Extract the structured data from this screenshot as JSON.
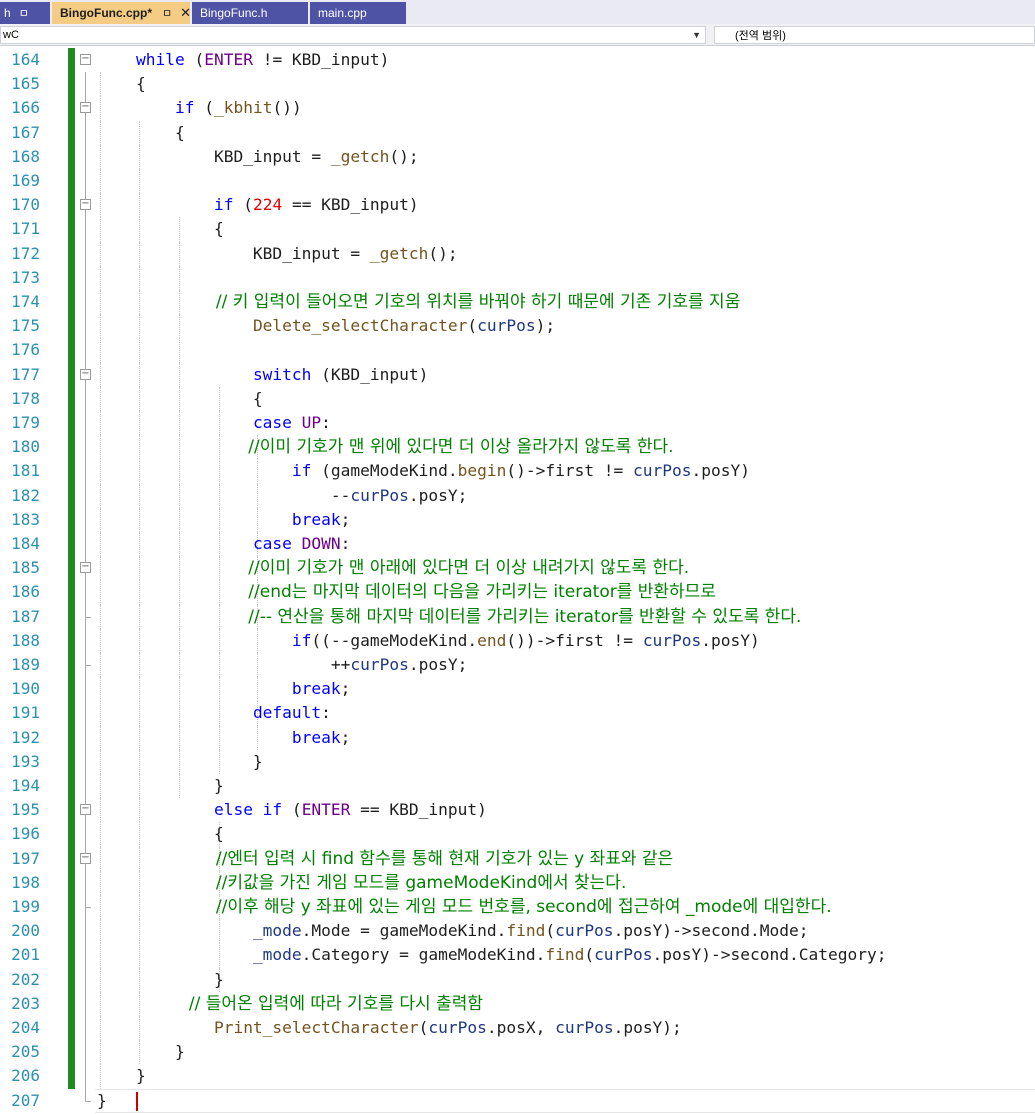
{
  "tabs": [
    {
      "label": "h",
      "pin": "ㅁ",
      "style": "edge"
    },
    {
      "label": "BingoFunc.cpp*",
      "pin": "ㅁ",
      "close": "✕",
      "style": "active"
    },
    {
      "label": "BingoFunc.h",
      "style": "inactive"
    },
    {
      "label": "main.cpp",
      "style": "inactive"
    }
  ],
  "navbar": {
    "left_value": "wC",
    "right_value": "(전역 범위)"
  },
  "colors": {
    "keyword": "#0000ff",
    "macro": "#6f008a",
    "function": "#74531f",
    "number": "#e00000",
    "variable": "#1f377f",
    "comment": "#008000",
    "line_number": "#2b91af",
    "change_bar": "#1f8a1f"
  },
  "editor": {
    "lines": [
      {
        "n": "164",
        "tokens": [
          {
            "t": "    "
          },
          {
            "t": "while",
            "c": "kw"
          },
          {
            "t": " ("
          },
          {
            "t": "ENTER",
            "c": "mac"
          },
          {
            "t": " != KBD_input)"
          }
        ]
      },
      {
        "n": "165",
        "tokens": [
          {
            "t": "    {"
          }
        ]
      },
      {
        "n": "166",
        "tokens": [
          {
            "t": "        "
          },
          {
            "t": "if",
            "c": "kw"
          },
          {
            "t": " ("
          },
          {
            "t": "_kbhit",
            "c": "fn"
          },
          {
            "t": "())"
          }
        ]
      },
      {
        "n": "167",
        "tokens": [
          {
            "t": "        {"
          }
        ]
      },
      {
        "n": "168",
        "tokens": [
          {
            "t": "            KBD_input = "
          },
          {
            "t": "_getch",
            "c": "fn"
          },
          {
            "t": "();"
          }
        ]
      },
      {
        "n": "169",
        "tokens": []
      },
      {
        "n": "170",
        "tokens": [
          {
            "t": "            "
          },
          {
            "t": "if",
            "c": "kw"
          },
          {
            "t": " ("
          },
          {
            "t": "224",
            "c": "num"
          },
          {
            "t": " == KBD_input)"
          }
        ]
      },
      {
        "n": "171",
        "tokens": [
          {
            "t": "            {"
          }
        ]
      },
      {
        "n": "172",
        "tokens": [
          {
            "t": "                KBD_input = "
          },
          {
            "t": "_getch",
            "c": "fn"
          },
          {
            "t": "();"
          }
        ]
      },
      {
        "n": "173",
        "tokens": []
      },
      {
        "n": "174",
        "comment": true,
        "tokens": [
          {
            "t": "                      // 키 입력이 들어오면 기호의 위치를 바꿔야 하기 때문에 기존 기호를 지움",
            "c": "cmt"
          }
        ]
      },
      {
        "n": "175",
        "tokens": [
          {
            "t": "                "
          },
          {
            "t": "Delete_selectCharacter",
            "c": "fn"
          },
          {
            "t": "("
          },
          {
            "t": "curPos",
            "c": "var"
          },
          {
            "t": ");"
          }
        ]
      },
      {
        "n": "176",
        "tokens": []
      },
      {
        "n": "177",
        "tokens": [
          {
            "t": "                "
          },
          {
            "t": "switch",
            "c": "kw"
          },
          {
            "t": " (KBD_input)"
          }
        ]
      },
      {
        "n": "178",
        "tokens": [
          {
            "t": "                {"
          }
        ]
      },
      {
        "n": "179",
        "tokens": [
          {
            "t": "                "
          },
          {
            "t": "case",
            "c": "kw"
          },
          {
            "t": " "
          },
          {
            "t": "UP",
            "c": "mac"
          },
          {
            "t": ":"
          }
        ]
      },
      {
        "n": "180",
        "comment": true,
        "tokens": [
          {
            "t": "                            //이미 기호가 맨 위에 있다면 더 이상 올라가지 않도록 한다.",
            "c": "cmt"
          }
        ]
      },
      {
        "n": "181",
        "tokens": [
          {
            "t": "                    "
          },
          {
            "t": "if",
            "c": "kw"
          },
          {
            "t": " (gameModeKind."
          },
          {
            "t": "begin",
            "c": "fn"
          },
          {
            "t": "()->first != "
          },
          {
            "t": "curPos",
            "c": "var"
          },
          {
            "t": ".posY)"
          }
        ]
      },
      {
        "n": "182",
        "tokens": [
          {
            "t": "                        --"
          },
          {
            "t": "curPos",
            "c": "var"
          },
          {
            "t": ".posY;"
          }
        ]
      },
      {
        "n": "183",
        "tokens": [
          {
            "t": "                    "
          },
          {
            "t": "break",
            "c": "kw"
          },
          {
            "t": ";"
          }
        ]
      },
      {
        "n": "184",
        "tokens": [
          {
            "t": "                "
          },
          {
            "t": "case",
            "c": "kw"
          },
          {
            "t": " "
          },
          {
            "t": "DOWN",
            "c": "mac"
          },
          {
            "t": ":"
          }
        ]
      },
      {
        "n": "185",
        "comment": true,
        "tokens": [
          {
            "t": "                            //이미 기호가 맨 아래에 있다면 더 이상 내려가지 않도록 한다.",
            "c": "cmt"
          }
        ]
      },
      {
        "n": "186",
        "comment": true,
        "tokens": [
          {
            "t": "                            //end는 마지막 데이터의 다음을 가리키는 iterator를 반환하므로",
            "c": "cmt"
          }
        ]
      },
      {
        "n": "187",
        "comment": true,
        "tokens": [
          {
            "t": "                            //-- 연산을 통해 마지막 데이터를 가리키는 iterator를 반환할 수 있도록 한다.",
            "c": "cmt"
          }
        ]
      },
      {
        "n": "188",
        "tokens": [
          {
            "t": "                    "
          },
          {
            "t": "if",
            "c": "kw"
          },
          {
            "t": "((--gameModeKind."
          },
          {
            "t": "end",
            "c": "fn"
          },
          {
            "t": "())->first != "
          },
          {
            "t": "curPos",
            "c": "var"
          },
          {
            "t": ".posY)"
          }
        ]
      },
      {
        "n": "189",
        "tokens": [
          {
            "t": "                        ++"
          },
          {
            "t": "curPos",
            "c": "var"
          },
          {
            "t": ".posY;"
          }
        ]
      },
      {
        "n": "190",
        "tokens": [
          {
            "t": "                    "
          },
          {
            "t": "break",
            "c": "kw"
          },
          {
            "t": ";"
          }
        ]
      },
      {
        "n": "191",
        "tokens": [
          {
            "t": "                "
          },
          {
            "t": "default",
            "c": "kw"
          },
          {
            "t": ":"
          }
        ]
      },
      {
        "n": "192",
        "tokens": [
          {
            "t": "                    "
          },
          {
            "t": "break",
            "c": "kw"
          },
          {
            "t": ";"
          }
        ]
      },
      {
        "n": "193",
        "tokens": [
          {
            "t": "                }"
          }
        ]
      },
      {
        "n": "194",
        "tokens": [
          {
            "t": "            }"
          }
        ]
      },
      {
        "n": "195",
        "tokens": [
          {
            "t": "            "
          },
          {
            "t": "else if",
            "c": "kw"
          },
          {
            "t": " ("
          },
          {
            "t": "ENTER",
            "c": "mac"
          },
          {
            "t": " == KBD_input)"
          }
        ]
      },
      {
        "n": "196",
        "tokens": [
          {
            "t": "            {"
          }
        ]
      },
      {
        "n": "197",
        "comment": true,
        "tokens": [
          {
            "t": "                      //엔터 입력 시 find 함수를 통해 현재 기호가 있는 y 좌표와 같은",
            "c": "cmt"
          }
        ]
      },
      {
        "n": "198",
        "comment": true,
        "tokens": [
          {
            "t": "                      //키값을 가진 게임 모드를 gameModeKind에서 찾는다.",
            "c": "cmt"
          }
        ]
      },
      {
        "n": "199",
        "comment": true,
        "tokens": [
          {
            "t": "                      //이후 해당 y 좌표에 있는 게임 모드 번호를, second에 접근하여 _mode에 대입한다.",
            "c": "cmt"
          }
        ]
      },
      {
        "n": "200",
        "tokens": [
          {
            "t": "                "
          },
          {
            "t": "_mode",
            "c": "var"
          },
          {
            "t": ".Mode = gameModeKind."
          },
          {
            "t": "find",
            "c": "fn"
          },
          {
            "t": "("
          },
          {
            "t": "curPos",
            "c": "var"
          },
          {
            "t": ".posY)->second.Mode;"
          }
        ]
      },
      {
        "n": "201",
        "tokens": [
          {
            "t": "                "
          },
          {
            "t": "_mode",
            "c": "var"
          },
          {
            "t": ".Category = gameModeKind."
          },
          {
            "t": "find",
            "c": "fn"
          },
          {
            "t": "("
          },
          {
            "t": "curPos",
            "c": "var"
          },
          {
            "t": ".posY)->second.Category;"
          }
        ]
      },
      {
        "n": "202",
        "tokens": [
          {
            "t": "            }"
          }
        ]
      },
      {
        "n": "203",
        "comment": true,
        "tokens": [
          {
            "t": "                 // 들어온 입력에 따라 기호를 다시 출력함",
            "c": "cmt"
          }
        ]
      },
      {
        "n": "204",
        "tokens": [
          {
            "t": "            "
          },
          {
            "t": "Print_selectCharacter",
            "c": "fn"
          },
          {
            "t": "("
          },
          {
            "t": "curPos",
            "c": "var"
          },
          {
            "t": ".posX, "
          },
          {
            "t": "curPos",
            "c": "var"
          },
          {
            "t": ".posY);"
          }
        ]
      },
      {
        "n": "205",
        "tokens": [
          {
            "t": "        }"
          }
        ]
      },
      {
        "n": "206",
        "tokens": [
          {
            "t": "    }"
          }
        ]
      },
      {
        "n": "207",
        "tokens": [
          {
            "t": "}"
          }
        ]
      }
    ]
  }
}
